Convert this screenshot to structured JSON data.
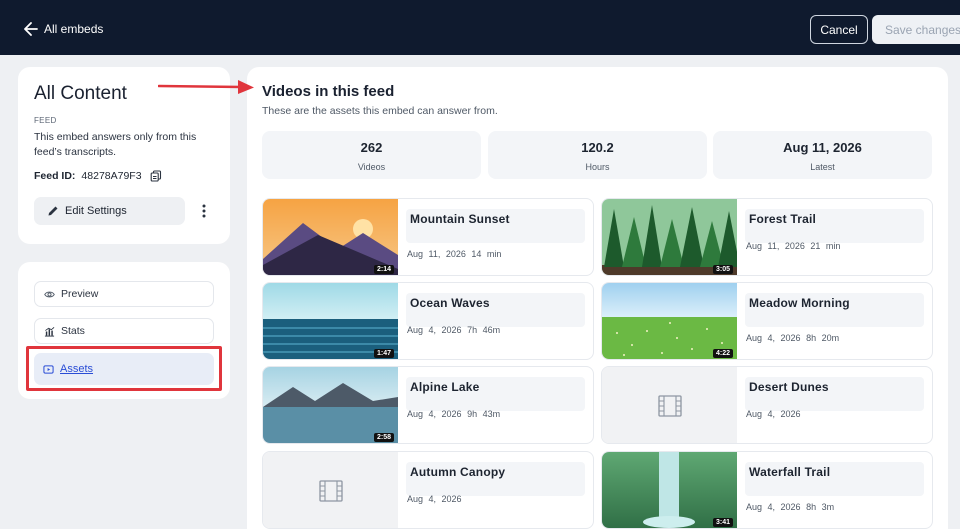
{
  "topbar": {
    "back_label": "All embeds",
    "cancel_label": "Cancel",
    "save_label": "Save changes"
  },
  "info": {
    "title": "All Content",
    "type_label": "FEED",
    "description": "This embed answers only from this feed’s transcripts.",
    "feed_id_label": "Feed ID:",
    "feed_id_value": "48278A79F3",
    "edit_label": "Edit Settings"
  },
  "nav": {
    "preview": "Preview",
    "stats": "Stats",
    "assets": "Assets"
  },
  "main": {
    "title": "Videos in this feed",
    "subtitle": "These are the assets this embed can answer from.",
    "stats": [
      {
        "value": "262",
        "label": "Videos"
      },
      {
        "value": "120.2",
        "label": "Hours"
      },
      {
        "value": "Aug 11, 2026",
        "label": "Latest"
      }
    ],
    "videos": [
      {
        "title": "Mountain Sunset",
        "date": "Aug 11, 2026",
        "length": "14 min",
        "duration": "2:14"
      },
      {
        "title": "Forest Trail",
        "date": "Aug 11, 2026",
        "length": "21 min",
        "duration": "3:05"
      },
      {
        "title": "Ocean Waves",
        "date": "Aug 4, 2026",
        "length": "7h 46m",
        "duration": "1:47"
      },
      {
        "title": "Meadow Morning",
        "date": "Aug 4, 2026",
        "length": "8h 20m",
        "duration": "4:22"
      },
      {
        "title": "Alpine Lake",
        "date": "Aug 4, 2026",
        "length": "9h 43m",
        "duration": "2:58"
      },
      {
        "title": "Desert Dunes",
        "date": "Aug 4, 2026",
        "length": "",
        "duration": ""
      },
      {
        "title": "Autumn Canopy",
        "date": "Aug 4, 2026",
        "length": "",
        "duration": ""
      },
      {
        "title": "Waterfall Trail",
        "date": "Aug 4, 2026",
        "length": "8h 3m",
        "duration": "3:41"
      }
    ]
  },
  "colors": {
    "topbar_bg": "#0f1a2e",
    "accent": "#2a4dd6",
    "highlight": "#e0353c"
  }
}
